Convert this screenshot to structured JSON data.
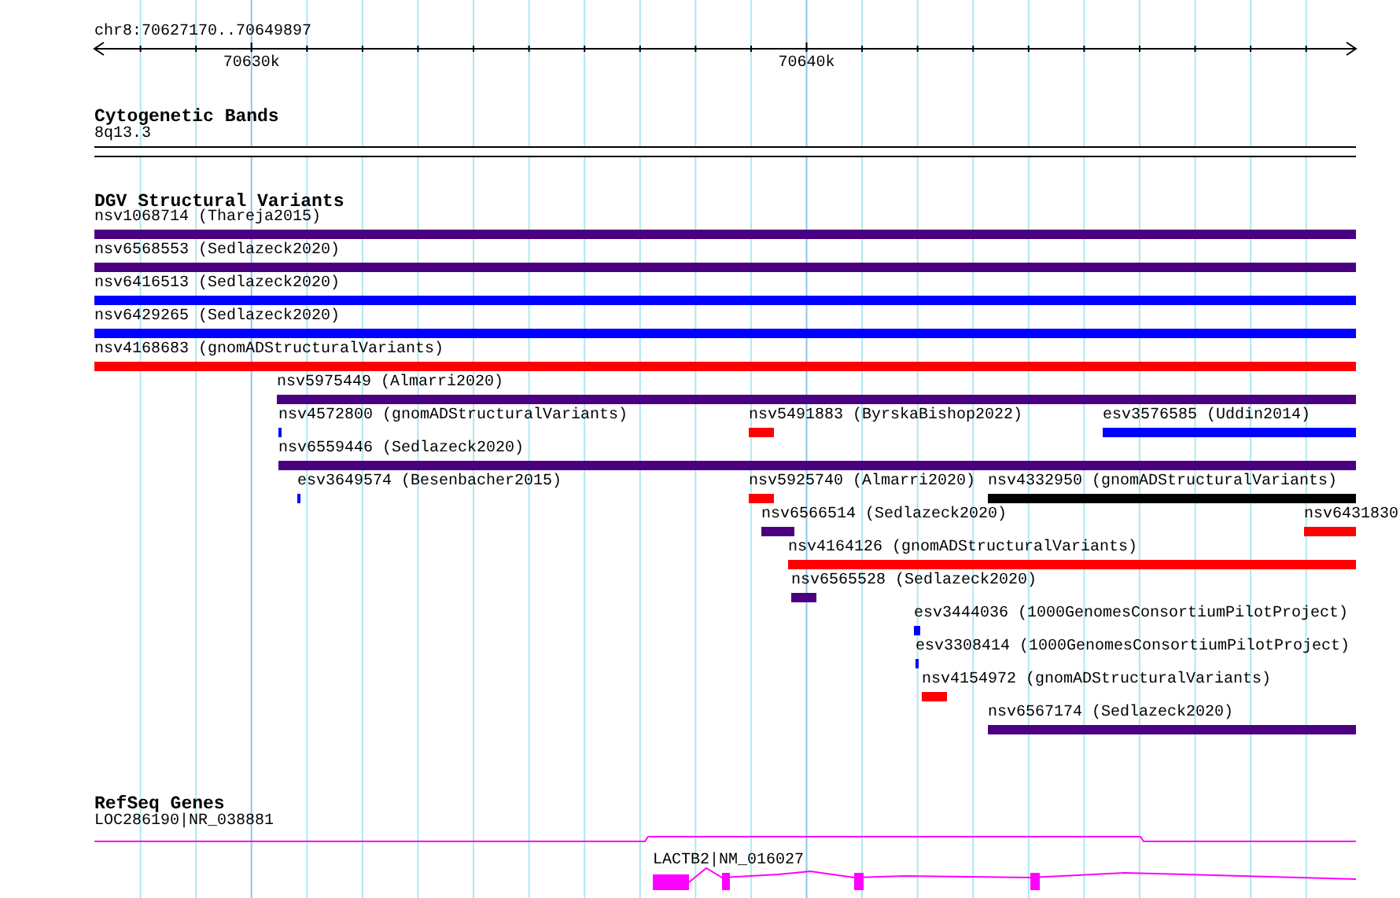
{
  "ruler": {
    "range": "chr8:70627170..70649897",
    "ticks": [
      {
        "label": "70630k"
      },
      {
        "label": "70640k"
      }
    ]
  },
  "tracks": [
    {
      "title": "Cytogenetic Bands",
      "kind": "bands",
      "features": [
        {
          "label": "8q13.3"
        }
      ]
    },
    {
      "title": "DGV Structural Variants",
      "kind": "variants",
      "features": [
        {
          "label": "nsv1068714 (Thareja2015)",
          "color": "#4b0082"
        },
        {
          "label": "nsv6568553 (Sedlazeck2020)",
          "color": "#4b0082"
        },
        {
          "label": "nsv6416513 (Sedlazeck2020)",
          "color": "#0000ff"
        },
        {
          "label": "nsv6429265 (Sedlazeck2020)",
          "color": "#0000ff"
        },
        {
          "label": "nsv4168683 (gnomADStructuralVariants)",
          "color": "#ff0000"
        },
        {
          "label": "nsv5975449 (Almarri2020)",
          "color": "#4b0082"
        },
        {
          "label": "nsv4572800 (gnomADStructuralVariants)",
          "color": "#0000ff"
        },
        {
          "label": "nsv5491883 (ByrskaBishop2022)",
          "color": "#ff0000"
        },
        {
          "label": "esv3576585 (Uddin2014)",
          "color": "#0000ff"
        },
        {
          "label": "nsv6559446 (Sedlazeck2020)",
          "color": "#4b0082"
        },
        {
          "label": "esv3649574 (Besenbacher2015)",
          "color": "#0000ff"
        },
        {
          "label": "nsv5925740 (Almarri2020)",
          "color": "#ff0000"
        },
        {
          "label": "nsv4332950 (gnomADStructuralVariants)",
          "color": "#000000"
        },
        {
          "label": "nsv6566514 (Sedlazeck2020)",
          "color": "#4b0082"
        },
        {
          "label": "nsv6431830",
          "color": "#ff0000"
        },
        {
          "label": "nsv4164126 (gnomADStructuralVariants)",
          "color": "#ff0000"
        },
        {
          "label": "nsv6565528 (Sedlazeck2020)",
          "color": "#4b0082"
        },
        {
          "label": "esv3444036 (1000GenomesConsortiumPilotProject)",
          "color": "#0000ff"
        },
        {
          "label": "esv3308414 (1000GenomesConsortiumPilotProject)",
          "color": "#0000ff"
        },
        {
          "label": "nsv4154972 (gnomADStructuralVariants)",
          "color": "#ff0000"
        },
        {
          "label": "nsv6567174 (Sedlazeck2020)",
          "color": "#4b0082"
        }
      ]
    },
    {
      "title": "RefSeq Genes",
      "kind": "genes",
      "features": [
        {
          "label": "LOC286190|NR_038881"
        },
        {
          "label": "LACTB2|NM_016027"
        }
      ]
    }
  ]
}
